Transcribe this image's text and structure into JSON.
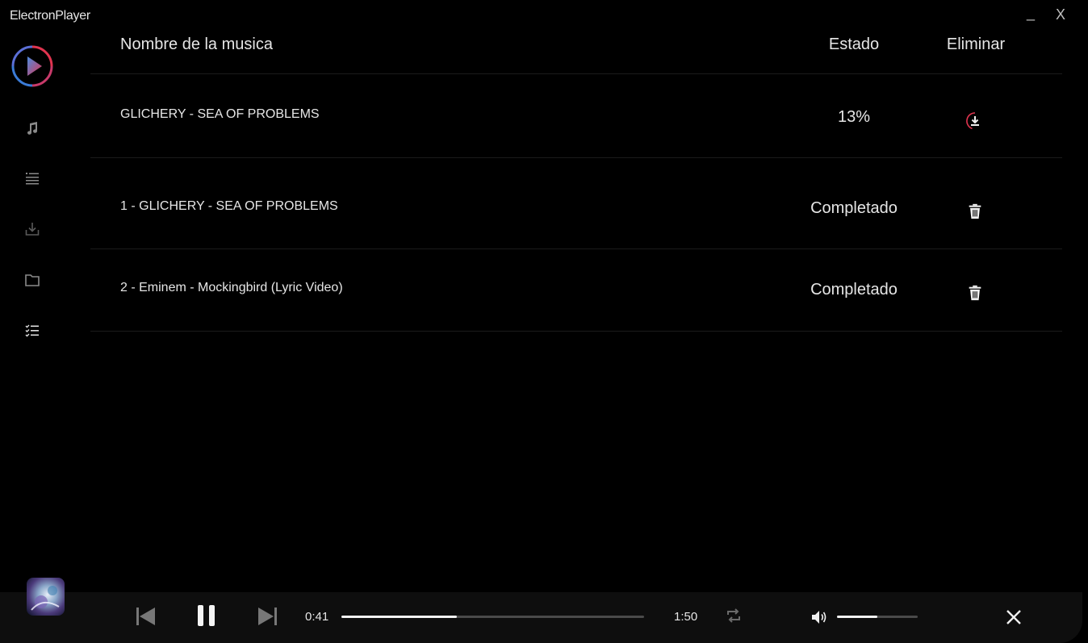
{
  "app": {
    "title": "ElectronPlayer",
    "minimize_label": "_",
    "close_label": "X"
  },
  "sidebar": {
    "items": [
      {
        "icon": "music-note-icon"
      },
      {
        "icon": "playlist-icon"
      },
      {
        "icon": "download-icon"
      },
      {
        "icon": "folder-icon"
      },
      {
        "icon": "checklist-icon"
      }
    ]
  },
  "table": {
    "headers": {
      "name": "Nombre de la musica",
      "state": "Estado",
      "delete": "Eliminar"
    },
    "rows": [
      {
        "name": "GLICHERY - SEA OF PROBLEMS",
        "state": "13%",
        "action_icon": "download-progress-icon",
        "progress": 0.13
      },
      {
        "name": "1 - GLICHERY - SEA OF PROBLEMS",
        "state": "Completado",
        "action_icon": "trash-icon"
      },
      {
        "name": "2 - Eminem - Mockingbird (Lyric Video)",
        "state": "Completado",
        "action_icon": "trash-icon"
      }
    ]
  },
  "player": {
    "current_time": "0:41",
    "total_time": "1:50",
    "progress": 0.38,
    "volume": 0.5
  },
  "colors": {
    "accent_red": "#e0344f",
    "accent_blue": "#3b7bd6",
    "accent_purple": "#7b5bd6"
  }
}
